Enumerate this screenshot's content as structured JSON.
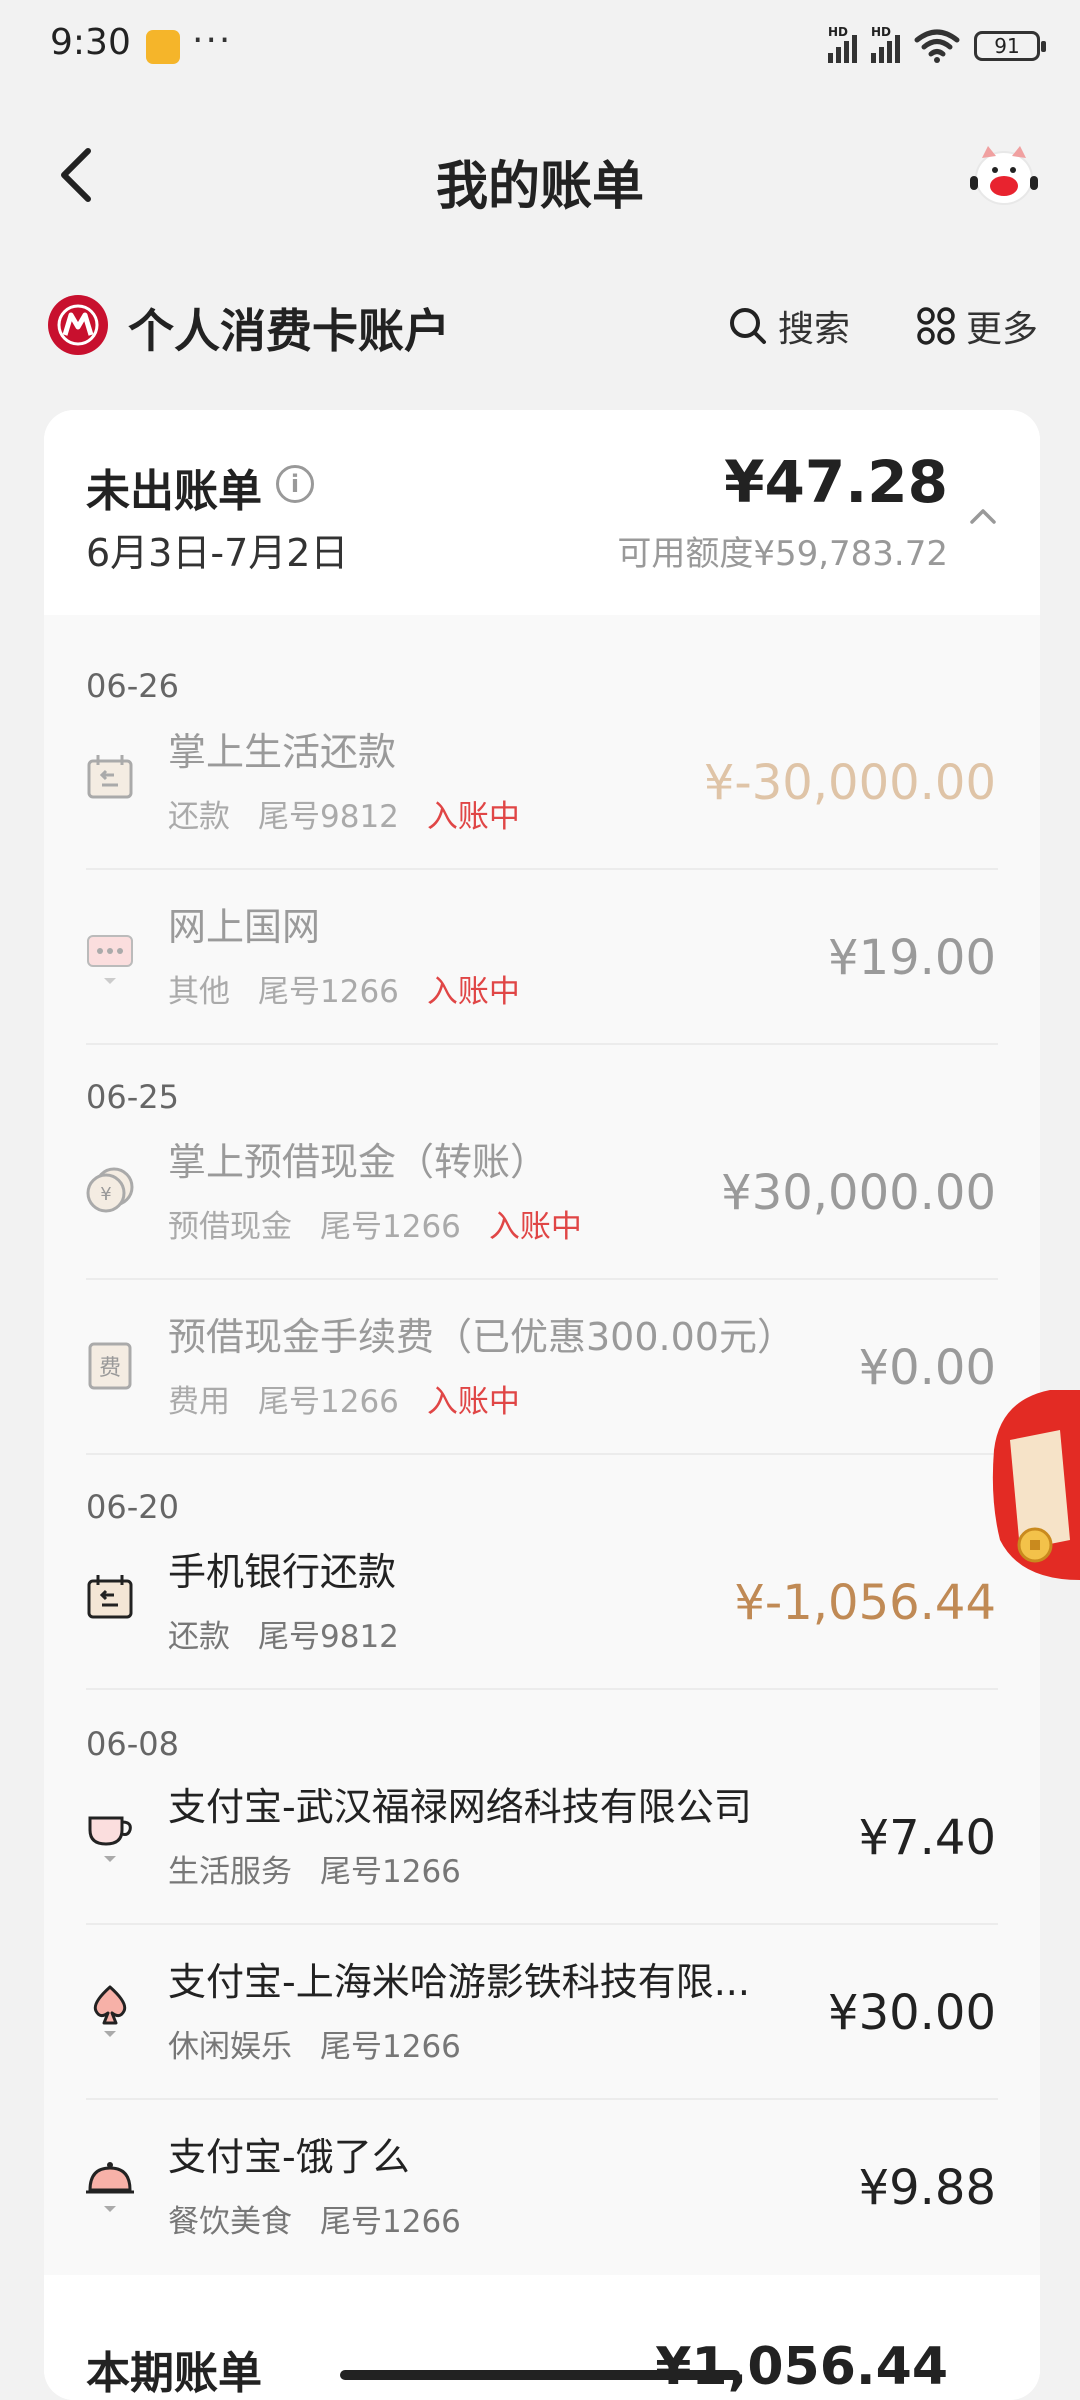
{
  "status_bar": {
    "time": "9:30",
    "dots": "···",
    "signal1_tag": "HD",
    "signal2_tag": "HD",
    "battery": "91"
  },
  "header": {
    "title": "我的账单",
    "back_icon": "chevron-left-icon",
    "mascot_icon": "mascot-icon"
  },
  "account": {
    "name": "个人消费卡账户",
    "search_label": "搜索",
    "more_label": "更多",
    "logo_color": "#c8102e"
  },
  "unbilled": {
    "title": "未出账单",
    "period": "6月3日-7月2日",
    "amount": "¥47.28",
    "available_credit": "可用额度¥59,783.72"
  },
  "dates": [
    "06-26",
    "06-25",
    "06-20",
    "06-08"
  ],
  "transactions": [
    {
      "title": "掌上生活还款",
      "category": "还款",
      "card": "尾号9812",
      "status": "入账中",
      "amount": "¥-30,000.00"
    },
    {
      "title": "网上国网",
      "category": "其他",
      "card": "尾号1266",
      "status": "入账中",
      "amount": "¥19.00"
    },
    {
      "title": "掌上预借现金（转账）",
      "category": "预借现金",
      "card": "尾号1266",
      "status": "入账中",
      "amount": "¥30,000.00"
    },
    {
      "title": "预借现金手续费（已优惠300.00元）",
      "category": "费用",
      "card": "尾号1266",
      "status": "入账中",
      "amount": "¥0.00",
      "icon_text": "费"
    },
    {
      "title": "手机银行还款",
      "category": "还款",
      "card": "尾号9812",
      "amount": "¥-1,056.44"
    },
    {
      "title": "支付宝-武汉福禄网络科技有限公司",
      "category": "生活服务",
      "card": "尾号1266",
      "amount": "¥7.40"
    },
    {
      "title": "支付宝-上海米哈游影铁科技有限...",
      "category": "休闲娱乐",
      "card": "尾号1266",
      "amount": "¥30.00"
    },
    {
      "title": "支付宝-饿了么",
      "category": "餐饮美食",
      "card": "尾号1266",
      "amount": "¥9.88"
    }
  ],
  "current_bill": {
    "title": "本期账单",
    "amount": "¥1,056.44"
  },
  "colors": {
    "pending": "#e03a3a",
    "repay": "#c08a55",
    "background": "#f2f2f2"
  }
}
